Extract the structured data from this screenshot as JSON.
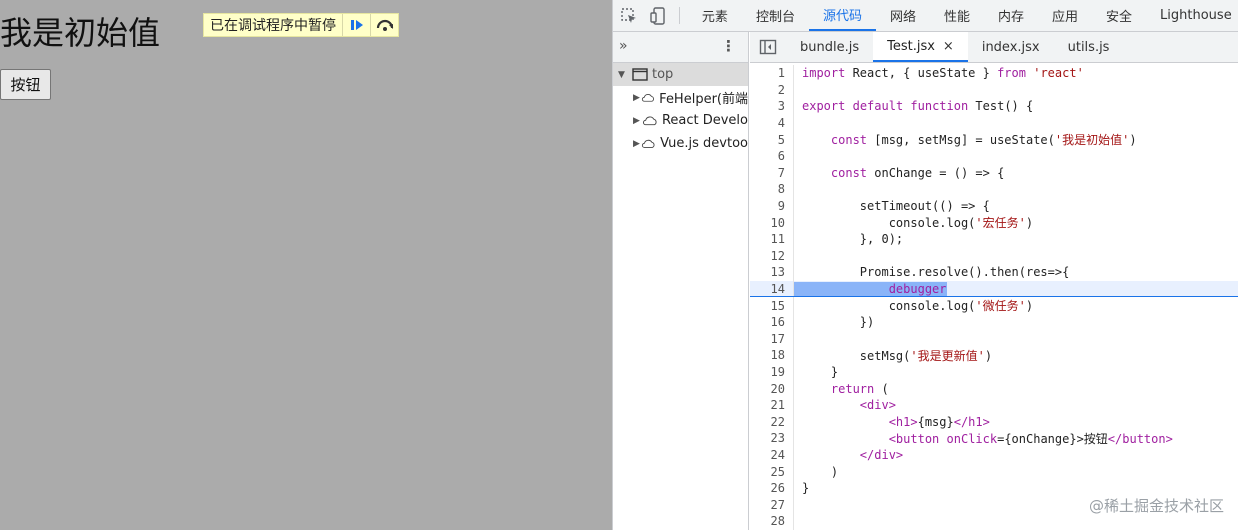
{
  "page": {
    "heading": "我是初始值",
    "paused_text": "已在调试程序中暂停",
    "button_label": "按钮"
  },
  "devtools": {
    "tabs": [
      "元素",
      "控制台",
      "源代码",
      "网络",
      "性能",
      "内存",
      "应用",
      "安全",
      "Lighthouse"
    ],
    "active_tab": "源代码",
    "navigator": {
      "more_label": "»",
      "kebab_label": "⋮",
      "top_label": "top",
      "extensions": [
        "FeHelper(前端",
        "React Develo",
        "Vue.js devtoo"
      ]
    },
    "file_tabs": [
      "bundle.js",
      "Test.jsx",
      "index.jsx",
      "utils.js"
    ],
    "active_file": "Test.jsx",
    "close_glyph": "×",
    "current_line": 14,
    "code_lines": [
      "import React, { useState } from 'react'",
      "",
      "export default function Test() {",
      "",
      "    const [msg, setMsg] = useState('我是初始值')",
      "",
      "    const onChange = () => {",
      "",
      "        setTimeout(() => {",
      "            console.log('宏任务')",
      "        }, 0);",
      "",
      "        Promise.resolve().then(res=>{",
      "            debugger",
      "            console.log('微任务')",
      "        })",
      "",
      "        setMsg('我是更新值')",
      "    }",
      "    return (",
      "        <div>",
      "            <h1>{msg}</h1>",
      "            <button onClick={onChange}>按钮</button>",
      "        </div>",
      "    )",
      "}",
      "",
      ""
    ],
    "watermark": "@稀土掘金技术社区"
  },
  "colors": {
    "accent": "#1a73e8",
    "paused_bg": "#ffffc8",
    "page_overlay": "#ababab"
  }
}
